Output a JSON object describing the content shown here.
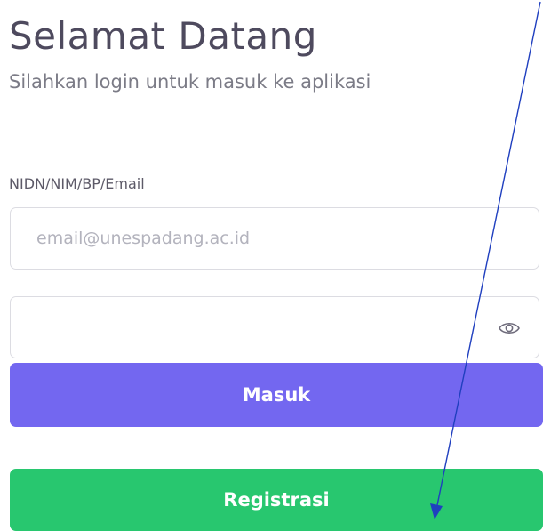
{
  "title": "Selamat Datang",
  "subtitle": "Silahkan login untuk masuk ke aplikasi",
  "login_form": {
    "username_label": "NIDN/NIM/BP/Email",
    "username_placeholder": "email@unespadang.ac.id",
    "password_value": "",
    "password_toggle_icon": "eye-icon"
  },
  "buttons": {
    "login_label": "Masuk",
    "register_label": "Registrasi"
  },
  "colors": {
    "login_button": "#7367f0",
    "register_button": "#28c76f",
    "annotation_arrow": "#1f3fbf"
  }
}
